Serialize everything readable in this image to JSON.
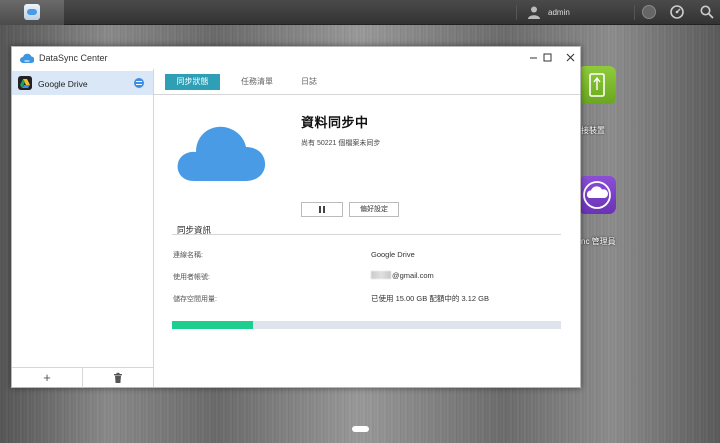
{
  "topbar": {
    "user_label": "admin",
    "icons": [
      "app-datasync-icon",
      "user-icon",
      "notification-icon",
      "status-dial-icon",
      "search-icon"
    ]
  },
  "desktop": {
    "icon1_label": "接裝置",
    "icon2_label": "nc 管理員",
    "icon1_color": "#7cb92e",
    "icon2_color": "#7a3fc6"
  },
  "window": {
    "title": "DataSync Center",
    "sidebar": {
      "items": [
        {
          "label": "Google Drive",
          "status_icon": "syncing-status-icon"
        }
      ]
    },
    "tabs": [
      {
        "label": "同步狀態",
        "active": true
      },
      {
        "label": "任務清單",
        "active": false
      },
      {
        "label": "日誌",
        "active": false
      }
    ],
    "status": {
      "title": "資料同步中",
      "subtitle": "尚有 50221 個檔案未同步",
      "settings_button": "偏好設定"
    },
    "info": {
      "section_title": "同步資訊",
      "rows": [
        {
          "label": "連線名稱:",
          "value": "Google Drive"
        },
        {
          "label": "使用者帳號:",
          "value": "@gmail.com"
        },
        {
          "label": "儲存空間用量:",
          "value": "已使用 15.00 GB 配額中的 3.12 GB"
        }
      ]
    },
    "progress": 0.208,
    "accent_color": "#2f9fb5",
    "progress_color": "#1ccf8e",
    "cloud_color": "#4a9be6"
  }
}
